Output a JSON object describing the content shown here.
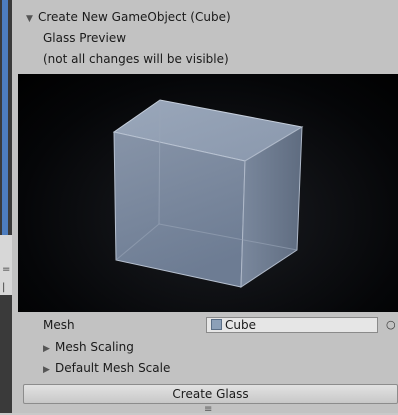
{
  "header": {
    "title": "Create New GameObject (Cube)",
    "subtitle": "Glass Preview",
    "note": "(not all changes will be visible)"
  },
  "fields": {
    "mesh_label": "Mesh",
    "mesh_value": "Cube",
    "mesh_scaling_label": "Mesh Scaling",
    "default_mesh_scale_label": "Default Mesh Scale"
  },
  "actions": {
    "create_glass_label": "Create Glass"
  },
  "icons": {
    "foldout": "triangle-right-icon",
    "foldout_open": "triangle-down-icon",
    "mesh_asset": "mesh-icon",
    "object_picker": "circle-picker-icon"
  },
  "colors": {
    "panel_bg": "#c2c2c2",
    "preview_bg": "#000000",
    "cube_face": "#8e9db0",
    "left_strip_accent": "#4d7dbf"
  }
}
